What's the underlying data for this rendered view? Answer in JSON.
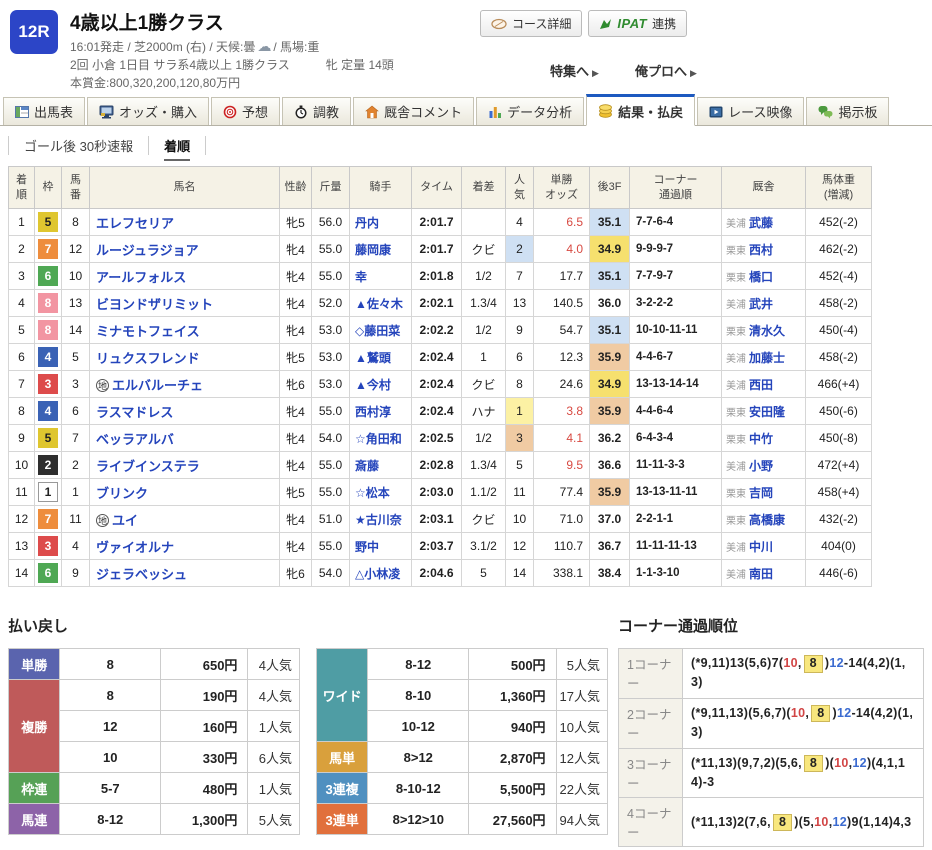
{
  "header": {
    "race_number": "12R",
    "title": "4歳以上1勝クラス",
    "meta1_pre": "16:01発走 / 芝2000m (右) / 天候:曇",
    "meta1_post": "/ 馬場:重",
    "meta2": "2回 小倉 1日目 サラ系4歳以上 1勝クラス　　　牝 定量 14頭",
    "meta3": "本賞金:800,320,200,120,80万円",
    "course_button": "コース詳細",
    "ipat_logo": "IPAT",
    "ipat_label": "連携",
    "link_special": "特集へ",
    "link_orepro": "俺プロへ"
  },
  "tabs": [
    {
      "label": "出馬表",
      "icon": "racecard-icon",
      "active": false
    },
    {
      "label": "オッズ・購入",
      "icon": "odds-icon",
      "active": false
    },
    {
      "label": "予想",
      "icon": "prediction-icon",
      "active": false
    },
    {
      "label": "調教",
      "icon": "training-icon",
      "active": false
    },
    {
      "label": "厩舎コメント",
      "icon": "stable-comment-icon",
      "active": false
    },
    {
      "label": "データ分析",
      "icon": "data-analysis-icon",
      "active": false
    },
    {
      "label": "結果・払戻",
      "icon": "result-icon",
      "active": true
    },
    {
      "label": "レース映像",
      "icon": "race-video-icon",
      "active": false
    },
    {
      "label": "掲示板",
      "icon": "board-icon",
      "active": false
    }
  ],
  "subnav": {
    "items": [
      {
        "label": "ゴール後 30秒速報",
        "active": false
      },
      {
        "label": "着順",
        "active": true
      }
    ]
  },
  "results": {
    "headers": [
      "着\n順",
      "枠",
      "馬\n番",
      "馬名",
      "性齢",
      "斤量",
      "騎手",
      "タイム",
      "着差",
      "人\n気",
      "単勝\nオッズ",
      "後3F",
      "コーナー\n通過順",
      "厩舎",
      "馬体重\n(増減)"
    ],
    "rows": [
      {
        "pos": "1",
        "frame": 5,
        "num": "8",
        "horse": "エレフセリア",
        "mark": "",
        "sexage": "牝5",
        "weight": "56.0",
        "jockey": "丹内",
        "time": "2:01.7",
        "margin": "",
        "pop": "4",
        "pop_hl": 0,
        "odds": "6.5",
        "odds_red": true,
        "l3f": "35.1",
        "l3f_hl": 2,
        "corner": "7-7-6-4",
        "region": "美浦",
        "trainer": "武藤",
        "hweight": "452(-2)"
      },
      {
        "pos": "2",
        "frame": 7,
        "num": "12",
        "horse": "ルージュラジョア",
        "mark": "",
        "sexage": "牝4",
        "weight": "55.0",
        "jockey": "藤岡康",
        "time": "2:01.7",
        "margin": "クビ",
        "pop": "2",
        "pop_hl": 2,
        "odds": "4.0",
        "odds_red": true,
        "l3f": "34.9",
        "l3f_hl": 1,
        "corner": "9-9-9-7",
        "region": "栗東",
        "trainer": "西村",
        "hweight": "462(-2)"
      },
      {
        "pos": "3",
        "frame": 6,
        "num": "10",
        "horse": "アールフォルス",
        "mark": "",
        "sexage": "牝4",
        "weight": "55.0",
        "jockey": "幸",
        "time": "2:01.8",
        "margin": "1/2",
        "pop": "7",
        "pop_hl": 0,
        "odds": "17.7",
        "odds_red": false,
        "l3f": "35.1",
        "l3f_hl": 2,
        "corner": "7-7-9-7",
        "region": "栗東",
        "trainer": "橋口",
        "hweight": "452(-4)"
      },
      {
        "pos": "4",
        "frame": 8,
        "num": "13",
        "horse": "ビヨンドザリミット",
        "mark": "",
        "sexage": "牝4",
        "weight": "52.0",
        "jockey": "▲佐々木",
        "time": "2:02.1",
        "margin": "1.3/4",
        "pop": "13",
        "pop_hl": 0,
        "odds": "140.5",
        "odds_red": false,
        "l3f": "36.0",
        "l3f_hl": 0,
        "corner": "3-2-2-2",
        "region": "美浦",
        "trainer": "武井",
        "hweight": "458(-2)"
      },
      {
        "pos": "5",
        "frame": 8,
        "num": "14",
        "horse": "ミナモトフェイス",
        "mark": "",
        "sexage": "牝4",
        "weight": "53.0",
        "jockey": "◇藤田菜",
        "time": "2:02.2",
        "margin": "1/2",
        "pop": "9",
        "pop_hl": 0,
        "odds": "54.7",
        "odds_red": false,
        "l3f": "35.1",
        "l3f_hl": 2,
        "corner": "10-10-11-11",
        "region": "栗東",
        "trainer": "清水久",
        "hweight": "450(-4)"
      },
      {
        "pos": "6",
        "frame": 4,
        "num": "5",
        "horse": "リュクスフレンド",
        "mark": "",
        "sexage": "牝5",
        "weight": "53.0",
        "jockey": "▲鷲頭",
        "time": "2:02.4",
        "margin": "1",
        "pop": "6",
        "pop_hl": 0,
        "odds": "12.3",
        "odds_red": false,
        "l3f": "35.9",
        "l3f_hl": 3,
        "corner": "4-4-6-7",
        "region": "美浦",
        "trainer": "加藤士",
        "hweight": "458(-2)"
      },
      {
        "pos": "7",
        "frame": 3,
        "num": "3",
        "horse": "エルバルーチェ",
        "mark": "地",
        "sexage": "牝6",
        "weight": "53.0",
        "jockey": "▲今村",
        "time": "2:02.4",
        "margin": "クビ",
        "pop": "8",
        "pop_hl": 0,
        "odds": "24.6",
        "odds_red": false,
        "l3f": "34.9",
        "l3f_hl": 1,
        "corner": "13-13-14-14",
        "region": "美浦",
        "trainer": "西田",
        "hweight": "466(+4)"
      },
      {
        "pos": "8",
        "frame": 4,
        "num": "6",
        "horse": "ラスマドレス",
        "mark": "",
        "sexage": "牝4",
        "weight": "55.0",
        "jockey": "西村淳",
        "time": "2:02.4",
        "margin": "ハナ",
        "pop": "1",
        "pop_hl": 1,
        "odds": "3.8",
        "odds_red": true,
        "l3f": "35.9",
        "l3f_hl": 3,
        "corner": "4-4-6-4",
        "region": "栗東",
        "trainer": "安田隆",
        "hweight": "450(-6)"
      },
      {
        "pos": "9",
        "frame": 5,
        "num": "7",
        "horse": "ベッラアルバ",
        "mark": "",
        "sexage": "牝4",
        "weight": "54.0",
        "jockey": "☆角田和",
        "time": "2:02.5",
        "margin": "1/2",
        "pop": "3",
        "pop_hl": 3,
        "odds": "4.1",
        "odds_red": true,
        "l3f": "36.2",
        "l3f_hl": 0,
        "corner": "6-4-3-4",
        "region": "栗東",
        "trainer": "中竹",
        "hweight": "450(-8)"
      },
      {
        "pos": "10",
        "frame": 2,
        "num": "2",
        "horse": "ライブインステラ",
        "mark": "",
        "sexage": "牝4",
        "weight": "55.0",
        "jockey": "斎藤",
        "time": "2:02.8",
        "margin": "1.3/4",
        "pop": "5",
        "pop_hl": 0,
        "odds": "9.5",
        "odds_red": true,
        "l3f": "36.6",
        "l3f_hl": 0,
        "corner": "11-11-3-3",
        "region": "美浦",
        "trainer": "小野",
        "hweight": "472(+4)"
      },
      {
        "pos": "11",
        "frame": 1,
        "num": "1",
        "horse": "ブリンク",
        "mark": "",
        "sexage": "牝5",
        "weight": "55.0",
        "jockey": "☆松本",
        "time": "2:03.0",
        "margin": "1.1/2",
        "pop": "11",
        "pop_hl": 0,
        "odds": "77.4",
        "odds_red": false,
        "l3f": "35.9",
        "l3f_hl": 3,
        "corner": "13-13-11-11",
        "region": "栗東",
        "trainer": "吉岡",
        "hweight": "458(+4)"
      },
      {
        "pos": "12",
        "frame": 7,
        "num": "11",
        "horse": "ユイ",
        "mark": "地",
        "sexage": "牝4",
        "weight": "51.0",
        "jockey": "★古川奈",
        "time": "2:03.1",
        "margin": "クビ",
        "pop": "10",
        "pop_hl": 0,
        "odds": "71.0",
        "odds_red": false,
        "l3f": "37.0",
        "l3f_hl": 0,
        "corner": "2-2-1-1",
        "region": "栗東",
        "trainer": "高橋康",
        "hweight": "432(-2)"
      },
      {
        "pos": "13",
        "frame": 3,
        "num": "4",
        "horse": "ヴァイオルナ",
        "mark": "",
        "sexage": "牝4",
        "weight": "55.0",
        "jockey": "野中",
        "time": "2:03.7",
        "margin": "3.1/2",
        "pop": "12",
        "pop_hl": 0,
        "odds": "110.7",
        "odds_red": false,
        "l3f": "36.7",
        "l3f_hl": 0,
        "corner": "11-11-11-13",
        "region": "美浦",
        "trainer": "中川",
        "hweight": "404(0)"
      },
      {
        "pos": "14",
        "frame": 6,
        "num": "9",
        "horse": "ジェラベッシュ",
        "mark": "",
        "sexage": "牝6",
        "weight": "54.0",
        "jockey": "△小林凌",
        "time": "2:04.6",
        "margin": "5",
        "pop": "14",
        "pop_hl": 0,
        "odds": "338.1",
        "odds_red": false,
        "l3f": "38.4",
        "l3f_hl": 0,
        "corner": "1-1-3-10",
        "region": "美浦",
        "trainer": "南田",
        "hweight": "446(-6)"
      }
    ]
  },
  "payout": {
    "title": "払い戻し",
    "left": [
      {
        "label": "単勝",
        "color": "#5a64ae",
        "rows": [
          [
            "8",
            "650円",
            "4人気"
          ]
        ]
      },
      {
        "label": "複勝",
        "color": "#bf5a5a",
        "rows": [
          [
            "8",
            "190円",
            "4人気"
          ],
          [
            "12",
            "160円",
            "1人気"
          ],
          [
            "10",
            "330円",
            "6人気"
          ]
        ]
      },
      {
        "label": "枠連",
        "color": "#56a156",
        "rows": [
          [
            "5-7",
            "480円",
            "1人気"
          ]
        ]
      },
      {
        "label": "馬連",
        "color": "#8d63a8",
        "rows": [
          [
            "8-12",
            "1,300円",
            "5人気"
          ]
        ]
      }
    ],
    "right": [
      {
        "label": "ワイド",
        "color": "#4f9da4",
        "rows": [
          [
            "8-12",
            "500円",
            "5人気"
          ],
          [
            "8-10",
            "1,360円",
            "17人気"
          ],
          [
            "10-12",
            "940円",
            "10人気"
          ]
        ]
      },
      {
        "label": "馬単",
        "color": "#d9a03c",
        "rows": [
          [
            "8>12",
            "2,870円",
            "12人気"
          ]
        ]
      },
      {
        "label": "3連複",
        "color": "#5090c0",
        "rows": [
          [
            "8-10-12",
            "5,500円",
            "22人気"
          ]
        ]
      },
      {
        "label": "3連単",
        "color": "#e1703c",
        "rows": [
          [
            "8>12>10",
            "27,560円",
            "94人気"
          ]
        ]
      }
    ]
  },
  "corners": {
    "title": "コーナー通過順位",
    "rows": [
      {
        "label": "1コーナー",
        "segments": [
          {
            "t": "(*9,11)13(5,6)7("
          },
          {
            "t": "10",
            "c": "c-red"
          },
          {
            "t": ","
          },
          {
            "t": "8",
            "c": "c-first"
          },
          {
            "t": ")"
          },
          {
            "t": "12",
            "c": "c-blue"
          },
          {
            "t": "-14(4,2)(1,3)"
          }
        ]
      },
      {
        "label": "2コーナー",
        "segments": [
          {
            "t": "(*9,11,13)(5,6,7)("
          },
          {
            "t": "10",
            "c": "c-red"
          },
          {
            "t": ","
          },
          {
            "t": "8",
            "c": "c-first"
          },
          {
            "t": ")"
          },
          {
            "t": "12",
            "c": "c-blue"
          },
          {
            "t": "-14(4,2)(1,3)"
          }
        ]
      },
      {
        "label": "3コーナー",
        "segments": [
          {
            "t": "(*11,13)(9,7,2)(5,6,"
          },
          {
            "t": "8",
            "c": "c-first"
          },
          {
            "t": ")("
          },
          {
            "t": "10",
            "c": "c-red"
          },
          {
            "t": ","
          },
          {
            "t": "12",
            "c": "c-blue"
          },
          {
            "t": ")(4,1,14)-3"
          }
        ]
      },
      {
        "label": "4コーナー",
        "segments": [
          {
            "t": "(*11,13)2(7,6,"
          },
          {
            "t": "8",
            "c": "c-first"
          },
          {
            "t": ")(5,"
          },
          {
            "t": "10",
            "c": "c-red"
          },
          {
            "t": ","
          },
          {
            "t": "12",
            "c": "c-blue"
          },
          {
            "t": ")9(1,14)4,3"
          }
        ]
      }
    ]
  },
  "colors": {
    "accent_blue": "#1d59c0",
    "link_blue": "#2444bb",
    "odds_red": "#d84a42",
    "hl_rank1": "#f6e06e",
    "hl_rank2": "#cfe0f3",
    "hl_rank3": "#f0cba3"
  }
}
